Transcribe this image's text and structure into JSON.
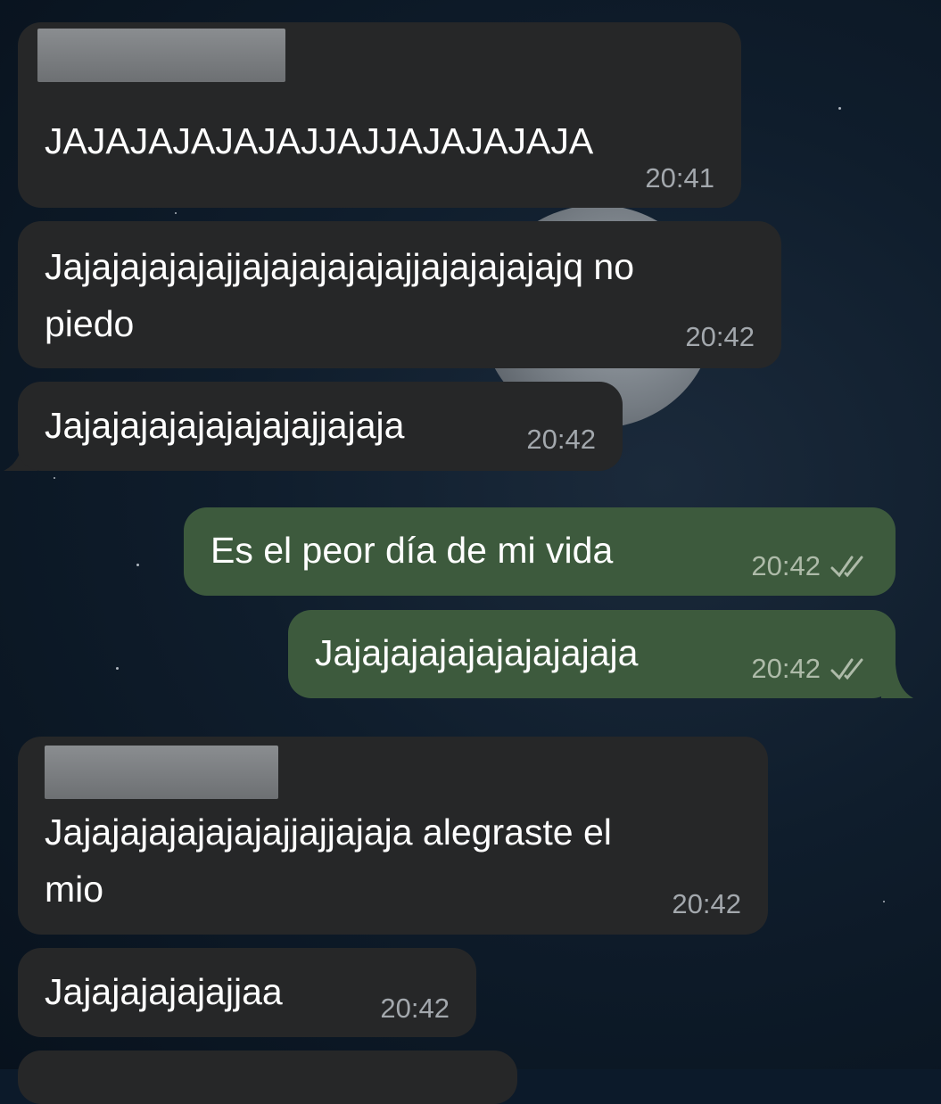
{
  "messages": [
    {
      "text": "JAJAJAJAJAJAJJAJJAJAJAJAJA",
      "time": "20:41",
      "direction": "incoming"
    },
    {
      "text_line1": "Jajajajajajajjajajajajajajjajajajajajq no",
      "text_line2": "piedo",
      "time": "20:42",
      "direction": "incoming"
    },
    {
      "text": "Jajajajajajajajajajjajaja",
      "time": "20:42",
      "direction": "incoming"
    },
    {
      "text": "Es el peor día de mi vida",
      "time": "20:42",
      "direction": "outgoing",
      "status": "read"
    },
    {
      "text": "Jajajajajajajajajajaja",
      "time": "20:42",
      "direction": "outgoing",
      "status": "read"
    },
    {
      "text_line1": "Jajajajajajajajajjajjajaja alegraste el",
      "text_line2": "mio",
      "time": "20:42",
      "direction": "incoming"
    },
    {
      "text": "Jajajajajajajjaa",
      "time": "20:42",
      "direction": "incoming"
    }
  ],
  "colors": {
    "incoming_bubble": "#262728",
    "outgoing_bubble": "#3d5a3d",
    "timestamp": "#a3a8ad",
    "background": "#0c1a2a"
  },
  "icons": {
    "read_receipt": "double-check-icon"
  }
}
